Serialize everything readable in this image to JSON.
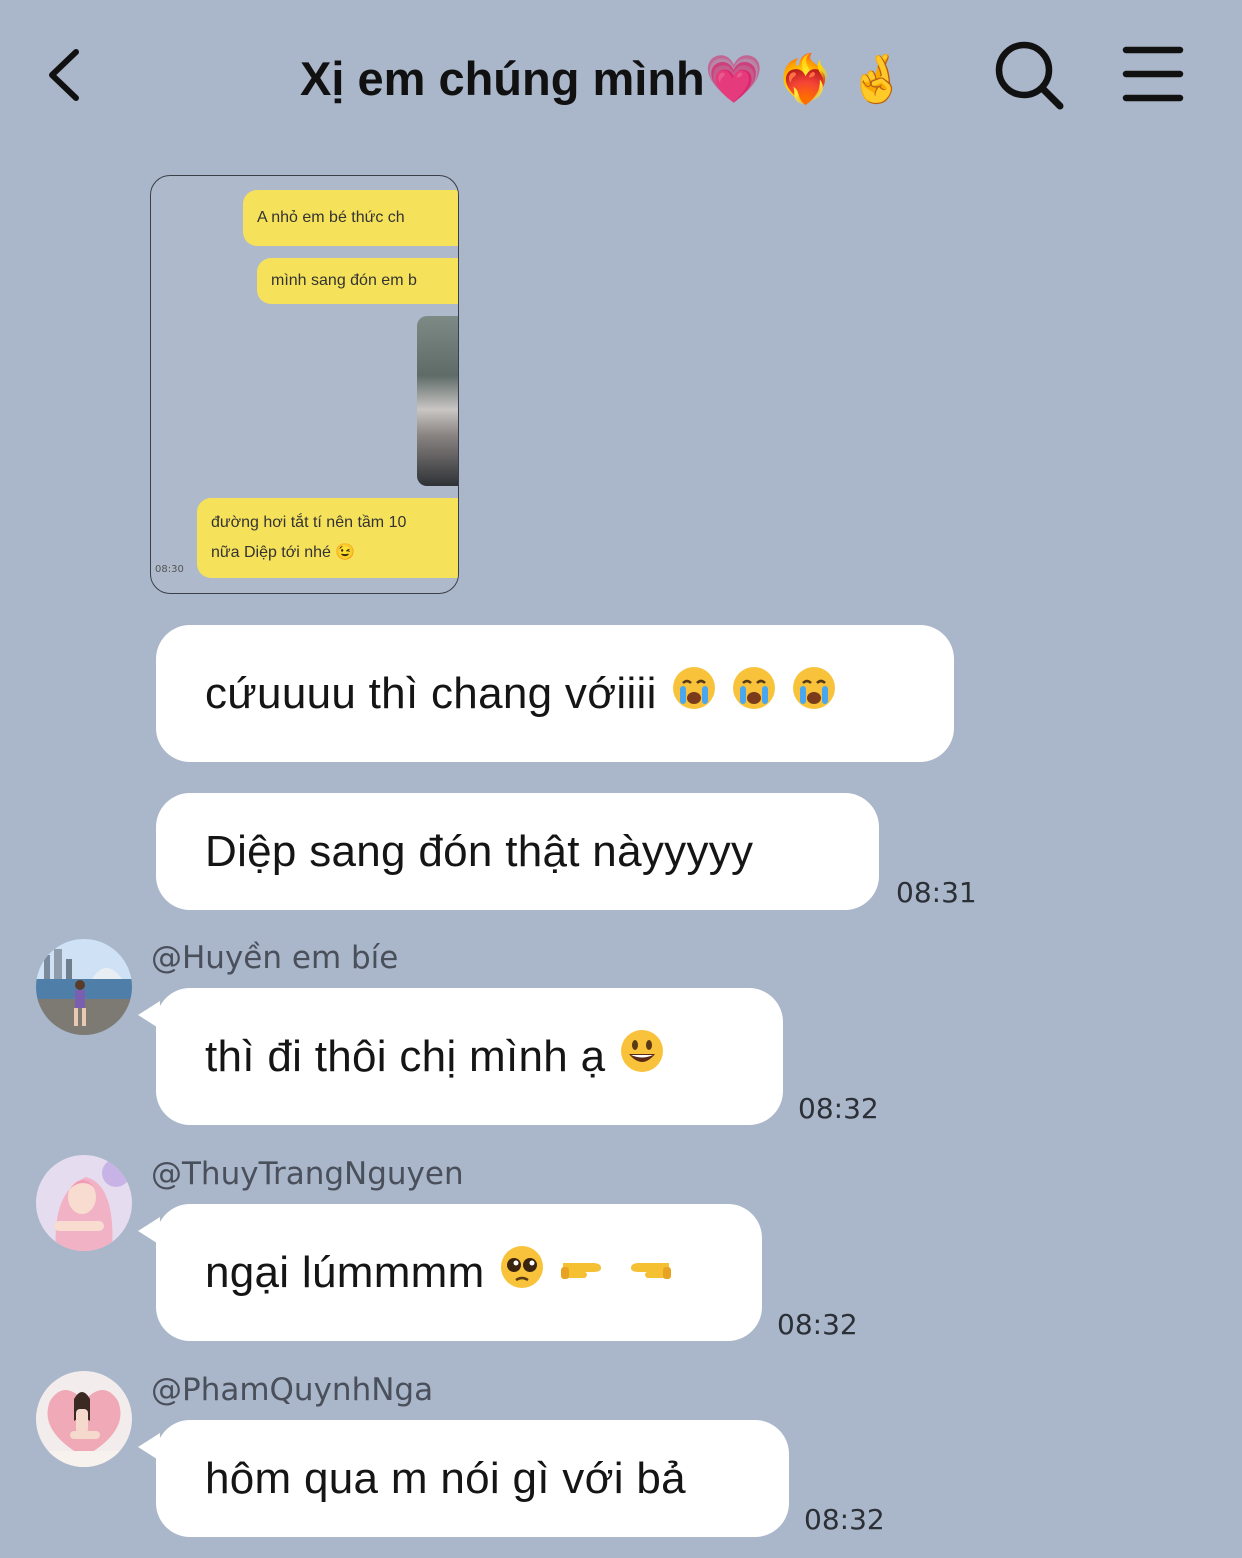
{
  "header": {
    "title": "Xị em chúng mình💗 ❤️‍🔥 🤞",
    "back_icon": "chevron-left-icon",
    "search_icon": "search-icon",
    "menu_icon": "hamburger-menu-icon"
  },
  "shared_image": {
    "bubbles": [
      "A nhỏ em bé thức ch",
      "mình sang đón em b",
      "đường hơi tắt tí nên tầm 10",
      "nữa Diệp tới nhé 😉"
    ],
    "time": "08:30"
  },
  "messages": [
    {
      "text": "cứuuuu thì chang vớiiii",
      "time": ""
    },
    {
      "text": "Diệp sang đón thật nàyyyyy",
      "time": "08:31"
    },
    {
      "sender": "@Huyền em bíe",
      "text": "thì đi thôi chị mình ạ",
      "time": "08:32"
    },
    {
      "sender": "@ThuyTrangNguyen",
      "text": "ngại lúmmmm",
      "time": "08:32"
    },
    {
      "sender": "@PhamQuynhNga",
      "text": "hôm qua m nói gì với bả",
      "time": "08:32"
    }
  ],
  "colors": {
    "background": "#aab6c9",
    "bubble": "#ffffff",
    "mini_bubble": "#f6e25a"
  }
}
